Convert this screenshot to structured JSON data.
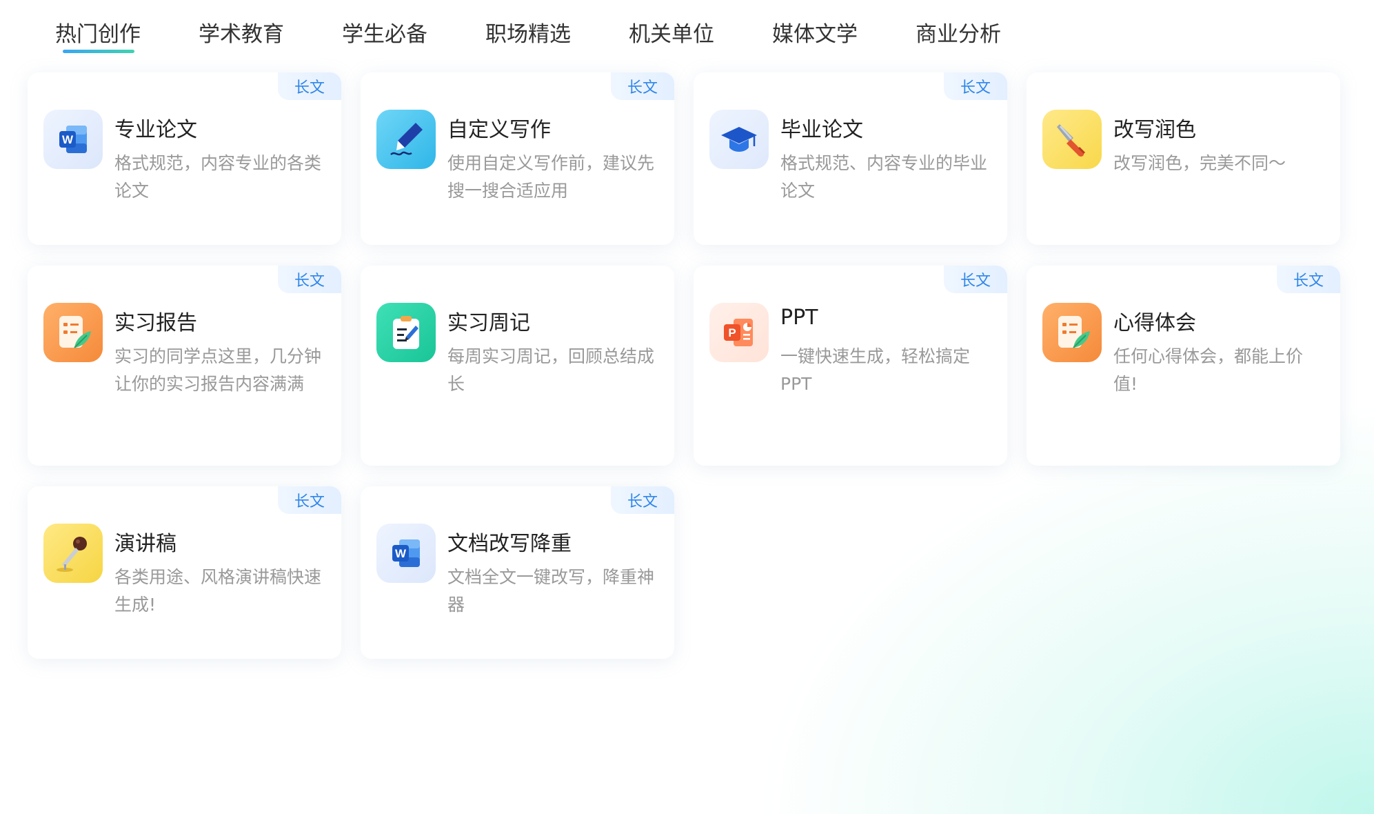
{
  "tabs": [
    {
      "label": "热门创作",
      "active": true
    },
    {
      "label": "学术教育"
    },
    {
      "label": "学生必备"
    },
    {
      "label": "职场精选"
    },
    {
      "label": "机关单位"
    },
    {
      "label": "媒体文学"
    },
    {
      "label": "商业分析"
    }
  ],
  "cards": [
    {
      "title": "专业论文",
      "desc": "格式规范，内容专业的各类论文",
      "badge": "长文",
      "icon": "word-doc-icon"
    },
    {
      "title": "自定义写作",
      "desc": "使用自定义写作前，建议先搜一搜合适应用",
      "badge": "长文",
      "icon": "pen-signature-icon"
    },
    {
      "title": "毕业论文",
      "desc": "格式规范、内容专业的毕业论文",
      "badge": "长文",
      "icon": "graduation-cap-icon"
    },
    {
      "title": "改写润色",
      "desc": "改写润色，完美不同～",
      "badge": "",
      "icon": "brush-icon"
    },
    {
      "title": "实习报告",
      "desc": "实习的同学点这里，几分钟让你的实习报告内容满满",
      "badge": "长文",
      "icon": "report-feather-icon"
    },
    {
      "title": "实习周记",
      "desc": "每周实习周记，回顾总结成长",
      "badge": "",
      "icon": "clipboard-pen-icon"
    },
    {
      "title": "PPT",
      "desc": "一键快速生成，轻松搞定PPT",
      "badge": "长文",
      "icon": "ppt-icon"
    },
    {
      "title": "心得体会",
      "desc": "任何心得体会，都能上价值!",
      "badge": "长文",
      "icon": "report-feather-icon"
    },
    {
      "title": "演讲稿",
      "desc": "各类用途、风格演讲稿快速生成!",
      "badge": "长文",
      "icon": "microphone-icon"
    },
    {
      "title": "文档改写降重",
      "desc": "文档全文一键改写，降重神器",
      "badge": "长文",
      "icon": "word-doc-icon"
    }
  ]
}
